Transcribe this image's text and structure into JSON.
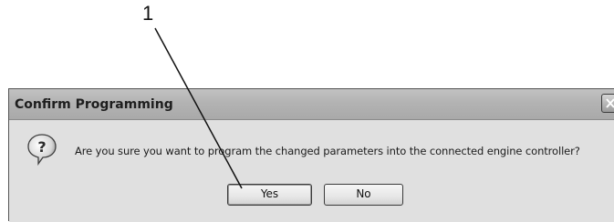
{
  "annotation": {
    "callout_label": "1"
  },
  "dialog": {
    "title": "Confirm Programming",
    "icon": "question-icon",
    "message": "Are you sure you want to program the changed parameters into the connected engine controller?",
    "buttons": {
      "yes_label": "Yes",
      "no_label": "No"
    }
  }
}
